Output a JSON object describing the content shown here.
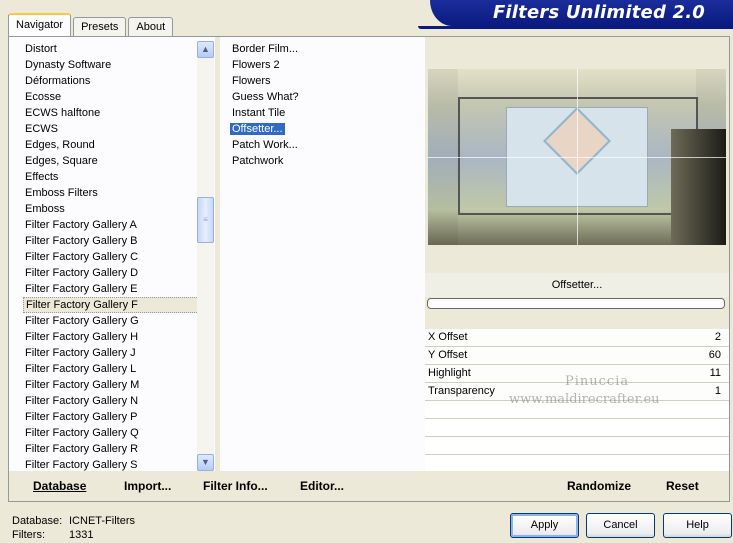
{
  "tabs": [
    "Navigator",
    "Presets",
    "About"
  ],
  "banner_title": "Filters Unlimited 2.0",
  "categories": [
    "Distort",
    "Dynasty Software",
    "Déformations",
    "Ecosse",
    "ECWS halftone",
    "ECWS",
    "Edges, Round",
    "Edges, Square",
    "Effects",
    "Emboss Filters",
    "Emboss",
    "Filter Factory Gallery A",
    "Filter Factory Gallery B",
    "Filter Factory Gallery C",
    "Filter Factory Gallery D",
    "Filter Factory Gallery E",
    "Filter Factory Gallery F",
    "Filter Factory Gallery G",
    "Filter Factory Gallery H",
    "Filter Factory Gallery J",
    "Filter Factory Gallery L",
    "Filter Factory Gallery M",
    "Filter Factory Gallery N",
    "Filter Factory Gallery P",
    "Filter Factory Gallery Q",
    "Filter Factory Gallery R",
    "Filter Factory Gallery S"
  ],
  "selected_category": "Filter Factory Gallery F",
  "filters": [
    "Border Film...",
    "Flowers 2",
    "Flowers",
    "Guess What?",
    "Instant Tile",
    "Offsetter...",
    "Patch Work...",
    "Patchwork"
  ],
  "selected_filter": "Offsetter...",
  "preview_filter_name": "Offsetter...",
  "params": [
    {
      "label": "X Offset",
      "value": "2"
    },
    {
      "label": "Y Offset",
      "value": "60"
    },
    {
      "label": "Highlight",
      "value": "11"
    },
    {
      "label": "Transparency",
      "value": "1"
    }
  ],
  "watermark": {
    "line1": "Pinuccia",
    "line2": "www.maldirecrafter.eu"
  },
  "bottom_buttons": {
    "database": "Database",
    "import": "Import...",
    "filter_info": "Filter Info...",
    "editor": "Editor...",
    "randomize": "Randomize",
    "reset": "Reset"
  },
  "footer": {
    "database_label": "Database:",
    "database_value": "ICNET-Filters",
    "filters_label": "Filters:",
    "filters_value": "1331"
  },
  "dialog_buttons": {
    "apply": "Apply",
    "cancel": "Cancel",
    "help": "Help"
  },
  "colors": {
    "banner": "#0a1a80",
    "selection": "#316ac5",
    "dialog_bg": "#ece9d8"
  }
}
